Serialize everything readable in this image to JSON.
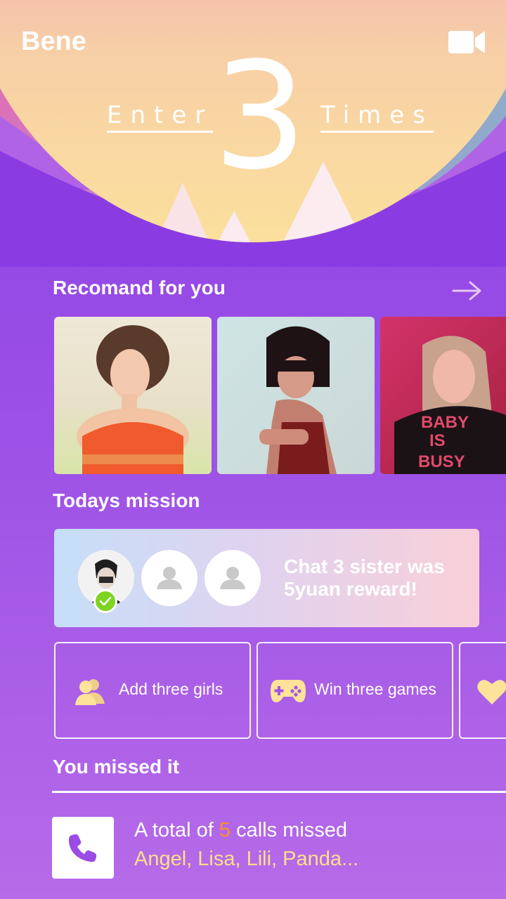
{
  "header": {
    "app_name": "Bene",
    "enter_label": "Enter",
    "count": "3",
    "times_label": "Times",
    "camera_icon": "video-camera-icon"
  },
  "recommend": {
    "title": "Recomand for you",
    "arrow_icon": "arrow-right-icon",
    "photos": [
      {
        "label": "recommended-profile-1"
      },
      {
        "label": "recommended-profile-2"
      },
      {
        "label": "recommended-profile-3",
        "shirt_text": "BABY IS BUSY"
      }
    ]
  },
  "mission": {
    "title": "Todays mission",
    "card_text": "Chat 3 sister was 5yuan reward!",
    "avatars": [
      {
        "state": "completed"
      },
      {
        "state": "empty"
      },
      {
        "state": "empty"
      }
    ],
    "tasks": [
      {
        "label": "Add three girls",
        "icon": "users-icon"
      },
      {
        "label": "Win three games",
        "icon": "gamepad-icon"
      },
      {
        "label": "",
        "icon": "heart-icon"
      }
    ]
  },
  "missed": {
    "title": "You missed it",
    "prefix": "A total of ",
    "count": "5",
    "suffix": " calls missed",
    "names": "Angel,  Lisa,  Lili,  Panda...",
    "icon": "phone-icon"
  },
  "colors": {
    "accent_orange": "#ff8c2b",
    "names_yellow": "#fddf8a",
    "icon_yellow": "#fde39a",
    "phone_purple": "#9a4ce4",
    "check_green": "#7ed321"
  }
}
